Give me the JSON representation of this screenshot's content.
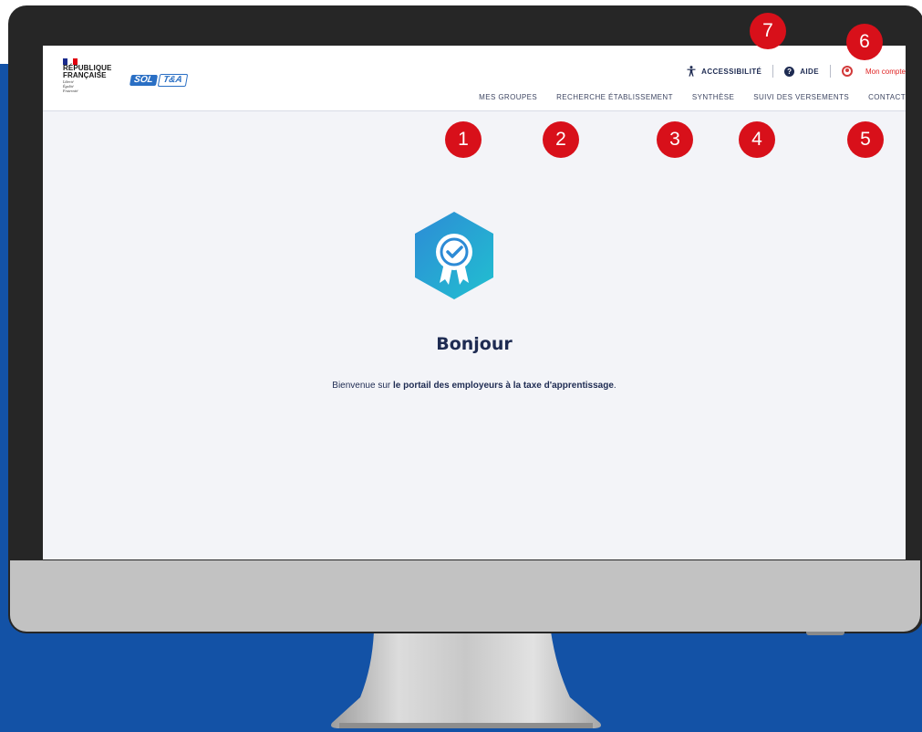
{
  "colors": {
    "backdrop": "#1352a6",
    "bezel": "#262626",
    "chin": "#c2c2c2",
    "marker": "#d8101a",
    "text_primary": "#1e2b52",
    "account_red": "#e02424",
    "badge_gradient_start": "#2d8bd6",
    "badge_gradient_end": "#21c0d0"
  },
  "logo": {
    "republique_line1": "RÉPUBLIQUE",
    "republique_line2": "FRANÇAISE",
    "motto_1": "Liberté",
    "motto_2": "Égalité",
    "motto_3": "Fraternité",
    "sol_text": "SOL",
    "ta_text": "T&A"
  },
  "top_links": {
    "accessibility_label": "ACCESSIBILITÉ",
    "accessibility_icon": "accessibility-person-icon",
    "help_label": "AIDE",
    "help_icon": "question-circle-icon",
    "help_icon_glyph": "?",
    "account_icon": "user-circle-icon",
    "account_label": "Mon compte"
  },
  "nav": {
    "items": [
      {
        "label": "MES GROUPES"
      },
      {
        "label": "RECHERCHE ÉTABLISSEMENT"
      },
      {
        "label": "SYNTHÈSE"
      },
      {
        "label": "SUIVI DES VERSEMENTS"
      },
      {
        "label": "CONTACT"
      }
    ]
  },
  "main": {
    "badge_icon": "award-ribbon-icon",
    "greeting": "Bonjour",
    "welcome_prefix": "Bienvenue sur ",
    "welcome_bold": "le portail des employeurs à la taxe d'apprentissage",
    "welcome_suffix": "."
  },
  "markers": [
    {
      "number": "1"
    },
    {
      "number": "2"
    },
    {
      "number": "3"
    },
    {
      "number": "4"
    },
    {
      "number": "5"
    },
    {
      "number": "6"
    },
    {
      "number": "7"
    }
  ]
}
